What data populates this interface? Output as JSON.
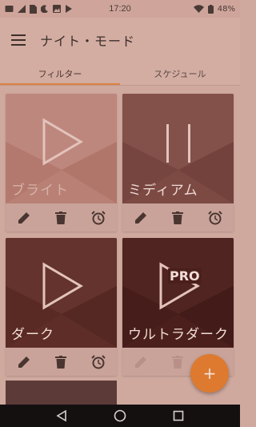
{
  "status_bar": {
    "time": "17:20",
    "battery": "48%"
  },
  "app_bar": {
    "title": "ナイト・モード"
  },
  "tabs": [
    {
      "label": "フィルター",
      "active": true
    },
    {
      "label": "スケジュール",
      "active": false
    }
  ],
  "cards": [
    {
      "label": "ブライト",
      "icon": "play-icon",
      "bg": "#b98076",
      "label_color": "#d7b1a8"
    },
    {
      "label": "ミディアム",
      "icon": "pause-icon",
      "bg": "#7c4a43",
      "label_color": "#f0dbd5"
    },
    {
      "label": "ダーク",
      "icon": "play-icon",
      "bg": "#5e2d27",
      "label_color": "#f2ddd6"
    },
    {
      "label": "ウルトラダーク",
      "icon": "play-pro-icon",
      "bg": "#4a1f1c",
      "label_color": "#f2ddd6",
      "badge": "PRO"
    }
  ],
  "colors": {
    "accent": "#dd7a30",
    "tab_indicator": "#d9823e"
  },
  "fab": {
    "label": "+"
  }
}
